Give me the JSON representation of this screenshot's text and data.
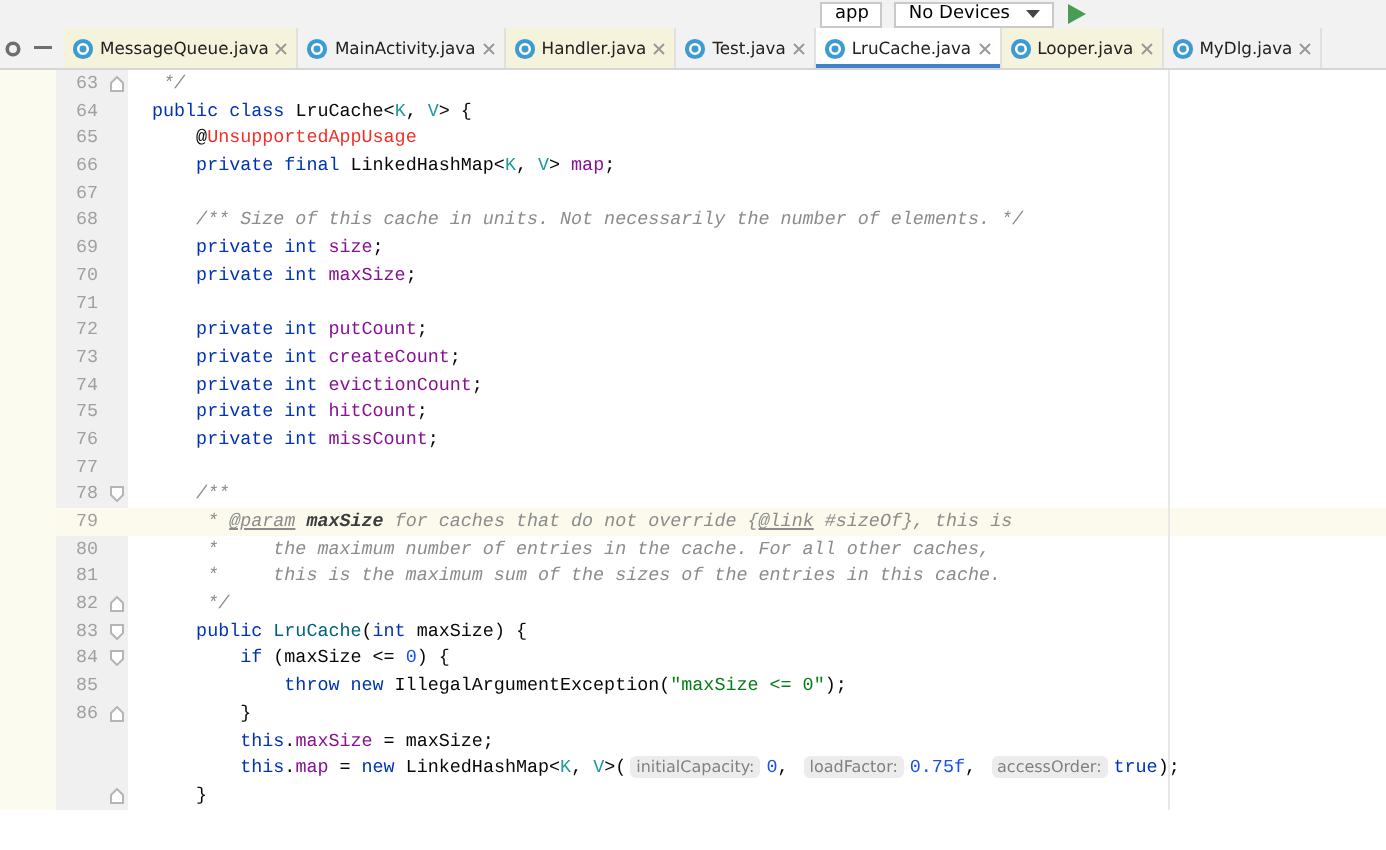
{
  "toolbar": {
    "config": "app",
    "device": "No Devices"
  },
  "tabs": [
    {
      "label": "MessageQueue.java",
      "selected": false,
      "library": true
    },
    {
      "label": "MainActivity.java",
      "selected": false,
      "library": false
    },
    {
      "label": "Handler.java",
      "selected": false,
      "library": true
    },
    {
      "label": "Test.java",
      "selected": false,
      "library": false
    },
    {
      "label": "LruCache.java",
      "selected": true,
      "library": false
    },
    {
      "label": "Looper.java",
      "selected": false,
      "library": true
    },
    {
      "label": "MyDlg.java",
      "selected": false,
      "library": false
    }
  ],
  "lines": [
    {
      "number": "63",
      "fold_end": true,
      "tokens": [
        {
          "kind": "comment",
          "text": " */"
        }
      ]
    },
    {
      "number": "64",
      "tokens": [
        {
          "kind": "kw",
          "text": "public class "
        },
        {
          "kind": "plain",
          "text": "LruCache<"
        },
        {
          "kind": "tparam",
          "text": "K"
        },
        {
          "kind": "plain",
          "text": ", "
        },
        {
          "kind": "tparam",
          "text": "V"
        },
        {
          "kind": "plain",
          "text": "> {"
        }
      ]
    },
    {
      "number": "65",
      "tokens": [
        {
          "kind": "plain",
          "text": "    @"
        },
        {
          "kind": "ann",
          "text": "UnsupportedAppUsage"
        }
      ]
    },
    {
      "number": "66",
      "tokens": [
        {
          "kind": "kw",
          "text": "    private final "
        },
        {
          "kind": "plain",
          "text": "LinkedHashMap<"
        },
        {
          "kind": "tparam",
          "text": "K"
        },
        {
          "kind": "plain",
          "text": ", "
        },
        {
          "kind": "tparam",
          "text": "V"
        },
        {
          "kind": "plain",
          "text": "> "
        },
        {
          "kind": "field",
          "text": "map"
        },
        {
          "kind": "plain",
          "text": ";"
        }
      ]
    },
    {
      "number": "67"
    },
    {
      "number": "68",
      "tokens": [
        {
          "kind": "comment",
          "text": "    /** Size of this cache in units. Not necessarily the number of elements. */"
        }
      ]
    },
    {
      "number": "69",
      "tokens": [
        {
          "kind": "kw",
          "text": "    private int "
        },
        {
          "kind": "field",
          "text": "size"
        },
        {
          "kind": "plain",
          "text": ";"
        }
      ]
    },
    {
      "number": "70",
      "tokens": [
        {
          "kind": "kw",
          "text": "    private int "
        },
        {
          "kind": "field",
          "text": "maxSize"
        },
        {
          "kind": "plain",
          "text": ";"
        }
      ]
    },
    {
      "number": "71"
    },
    {
      "number": "72",
      "tokens": [
        {
          "kind": "kw",
          "text": "    private int "
        },
        {
          "kind": "field",
          "text": "putCount"
        },
        {
          "kind": "plain",
          "text": ";"
        }
      ]
    },
    {
      "number": "73",
      "tokens": [
        {
          "kind": "kw",
          "text": "    private int "
        },
        {
          "kind": "field",
          "text": "createCount"
        },
        {
          "kind": "plain",
          "text": ";"
        }
      ]
    },
    {
      "number": "74",
      "tokens": [
        {
          "kind": "kw",
          "text": "    private int "
        },
        {
          "kind": "field",
          "text": "evictionCount"
        },
        {
          "kind": "plain",
          "text": ";"
        }
      ]
    },
    {
      "number": "75",
      "tokens": [
        {
          "kind": "kw",
          "text": "    private int "
        },
        {
          "kind": "field",
          "text": "hitCount"
        },
        {
          "kind": "plain",
          "text": ";"
        }
      ]
    },
    {
      "number": "76",
      "tokens": [
        {
          "kind": "kw",
          "text": "    private int "
        },
        {
          "kind": "field",
          "text": "missCount"
        },
        {
          "kind": "plain",
          "text": ";"
        }
      ]
    },
    {
      "number": "77"
    },
    {
      "number": "78",
      "fold_start": true,
      "tokens": [
        {
          "kind": "comment",
          "text": "    /**"
        }
      ]
    },
    {
      "number": "79",
      "current": true,
      "tokens": [
        {
          "kind": "comment",
          "text": "     * "
        },
        {
          "kind": "doctag",
          "text": "@param"
        },
        {
          "kind": "docparam",
          "text": " maxSize"
        },
        {
          "kind": "comment",
          "text": " for caches that do not override {"
        },
        {
          "kind": "doctag",
          "text": "@link"
        },
        {
          "kind": "comment",
          "text": " #sizeOf}, this is"
        }
      ]
    },
    {
      "number": "80",
      "tokens": [
        {
          "kind": "comment",
          "text": "     *     the maximum number of entries in the cache. For all other caches,"
        }
      ]
    },
    {
      "number": "81",
      "tokens": [
        {
          "kind": "comment",
          "text": "     *     this is the maximum sum of the sizes of the entries in this cache."
        }
      ]
    },
    {
      "number": "82",
      "fold_end": true,
      "tokens": [
        {
          "kind": "comment",
          "text": "     */"
        }
      ]
    },
    {
      "number": "83",
      "fold_start": true,
      "tokens": [
        {
          "kind": "kw",
          "text": "    public "
        },
        {
          "kind": "method",
          "text": "LruCache"
        },
        {
          "kind": "plain",
          "text": "("
        },
        {
          "kind": "kw",
          "text": "int "
        },
        {
          "kind": "plain",
          "text": "maxSize) {"
        }
      ]
    },
    {
      "number": "84",
      "fold_start": true,
      "tokens": [
        {
          "kind": "kw",
          "text": "        if "
        },
        {
          "kind": "plain",
          "text": "(maxSize <= "
        },
        {
          "kind": "num",
          "text": "0"
        },
        {
          "kind": "plain",
          "text": ") {"
        }
      ]
    },
    {
      "number": "85",
      "tokens": [
        {
          "kind": "kw",
          "text": "            throw new "
        },
        {
          "kind": "plain",
          "text": "IllegalArgumentException("
        },
        {
          "kind": "str",
          "text": "\"maxSize <= 0\""
        },
        {
          "kind": "plain",
          "text": ");"
        }
      ]
    },
    {
      "number": "86",
      "fold_end": true,
      "tokens": [
        {
          "kind": "plain",
          "text": "        }"
        }
      ]
    },
    {
      "tokens": [
        {
          "kind": "kw",
          "text": "        this"
        },
        {
          "kind": "plain",
          "text": "."
        },
        {
          "kind": "field",
          "text": "maxSize"
        },
        {
          "kind": "plain",
          "text": " = maxSize;"
        }
      ]
    },
    {
      "tokens": [
        {
          "kind": "kw",
          "text": "        this"
        },
        {
          "kind": "plain",
          "text": "."
        },
        {
          "kind": "field",
          "text": "map"
        },
        {
          "kind": "plain",
          "text": " = "
        },
        {
          "kind": "kw",
          "text": "new "
        },
        {
          "kind": "plain",
          "text": "LinkedHashMap<"
        },
        {
          "kind": "tparam",
          "text": "K"
        },
        {
          "kind": "plain",
          "text": ", "
        },
        {
          "kind": "tparam",
          "text": "V"
        },
        {
          "kind": "plain",
          "text": ">("
        },
        {
          "kind": "hint",
          "text": "initialCapacity:"
        },
        {
          "kind": "num",
          "text": "0"
        },
        {
          "kind": "plain",
          "text": ", "
        },
        {
          "kind": "hint",
          "text": "loadFactor:"
        },
        {
          "kind": "num",
          "text": "0.75f"
        },
        {
          "kind": "plain",
          "text": ", "
        },
        {
          "kind": "hint",
          "text": "accessOrder:"
        },
        {
          "kind": "kw",
          "text": "true"
        },
        {
          "kind": "plain",
          "text": ");"
        }
      ]
    },
    {
      "fold_end": true,
      "tokens": [
        {
          "kind": "plain",
          "text": "    }"
        }
      ]
    }
  ]
}
